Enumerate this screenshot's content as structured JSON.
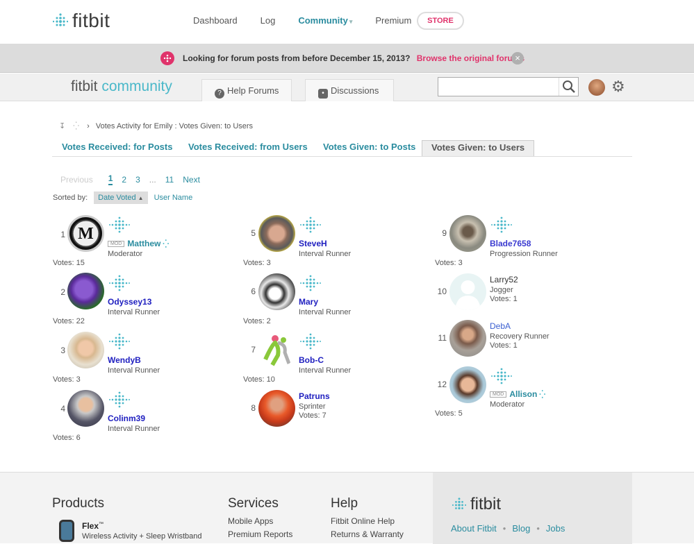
{
  "header": {
    "logo_text": "fitbit",
    "nav": [
      "Dashboard",
      "Log",
      "Community",
      "Premium"
    ],
    "store_label": "STORE"
  },
  "banner": {
    "text": "Looking for forum posts from before December 15, 2013?",
    "link": "Browse the original forums",
    "close": "×"
  },
  "community_bar": {
    "logo_part1": "fitbit",
    "logo_part2": " community",
    "help_forums": "Help Forums",
    "discussions": "Discussions",
    "search_placeholder": ""
  },
  "breadcrumb": {
    "text": "Votes Activity for Emily : Votes Given: to Users"
  },
  "tabs": [
    "Votes Received: for Posts",
    "Votes Received: from Users",
    "Votes Given: to Posts",
    "Votes Given: to Users"
  ],
  "pager": {
    "previous": "Previous",
    "pages": [
      "1",
      "2",
      "3"
    ],
    "ellipsis": "...",
    "last": "11",
    "next": "Next"
  },
  "sort": {
    "label": "Sorted by:",
    "active": "Date Voted",
    "other": "User Name"
  },
  "users": [
    {
      "rank": "1",
      "name": "Matthew",
      "title": "Moderator",
      "votes": "Votes: 15",
      "mod": "MOD"
    },
    {
      "rank": "2",
      "name": "Odyssey13",
      "title": "Interval Runner",
      "votes": "Votes: 22"
    },
    {
      "rank": "3",
      "name": "WendyB",
      "title": "Interval Runner",
      "votes": "Votes: 3"
    },
    {
      "rank": "4",
      "name": "Colinm39",
      "title": "Interval Runner",
      "votes": "Votes: 6"
    },
    {
      "rank": "5",
      "name": "SteveH",
      "title": "Interval Runner",
      "votes": "Votes: 3"
    },
    {
      "rank": "6",
      "name": "Mary",
      "title": "Interval Runner",
      "votes": "Votes: 2"
    },
    {
      "rank": "7",
      "name": "Bob-C",
      "title": "Interval Runner",
      "votes": "Votes: 10"
    },
    {
      "rank": "8",
      "name": "Patruns",
      "title": "Sprinter",
      "votes": "Votes: 7"
    },
    {
      "rank": "9",
      "name": "Blade7658",
      "title": "Progression Runner",
      "votes": "Votes: 3"
    },
    {
      "rank": "10",
      "name": "Larry52",
      "title": "Jogger",
      "votes": "Votes: 1"
    },
    {
      "rank": "11",
      "name": "DebA",
      "title": "Recovery Runner",
      "votes": "Votes: 1"
    },
    {
      "rank": "12",
      "name": "Allison",
      "title": "Moderator",
      "votes": "Votes: 5",
      "mod": "MOD"
    }
  ],
  "footer": {
    "products": "Products",
    "flex_name": "Flex",
    "flex_tm": "™",
    "flex_desc": "Wireless Activity + Sleep Wristband",
    "services": "Services",
    "services_links": [
      "Mobile Apps",
      "Premium Reports"
    ],
    "help": "Help",
    "help_links": [
      "Fitbit Online Help",
      "Returns & Warranty"
    ],
    "brand": "fitbit",
    "brand_links": [
      "About Fitbit",
      "Blog",
      "Jobs"
    ],
    "sep": "•"
  },
  "colors": {
    "accent": "#2a8c9f",
    "brand_pink": "#e0336b",
    "spark_blue": "#4ab8c9"
  }
}
